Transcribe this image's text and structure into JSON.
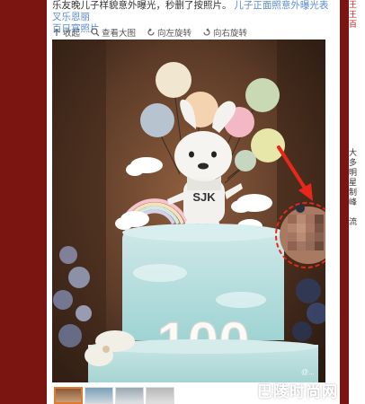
{
  "post": {
    "text_line1": "乐友晚儿子样貌意外曝光，秒删了按照片。",
    "text_link": "儿子正面照意外曝光表叉乐恩丽",
    "text_line2": "百日宴照片"
  },
  "toolbar": {
    "collapse": "收起",
    "view_large": "查看大图",
    "rotate_left": "向左旋转",
    "rotate_right": "向右旋转"
  },
  "photo": {
    "cake_topper": "SJK",
    "cake_number": "100"
  },
  "watermark": {
    "small": "@...",
    "big": "巴陵时尚网"
  },
  "right_column": {
    "lines": [
      "王",
      "王",
      "百",
      "",
      "",
      "",
      "",
      "",
      "",
      "",
      "",
      "",
      "",
      "",
      "",
      "大",
      "多",
      "明",
      "星",
      "制",
      "峰",
      "",
      "流",
      "",
      "",
      ""
    ]
  },
  "colors": {
    "background": "#7a1512",
    "link": "#5b8bd0",
    "arrow": "#e8261a",
    "thumb_active_border": "#e07a2c"
  }
}
